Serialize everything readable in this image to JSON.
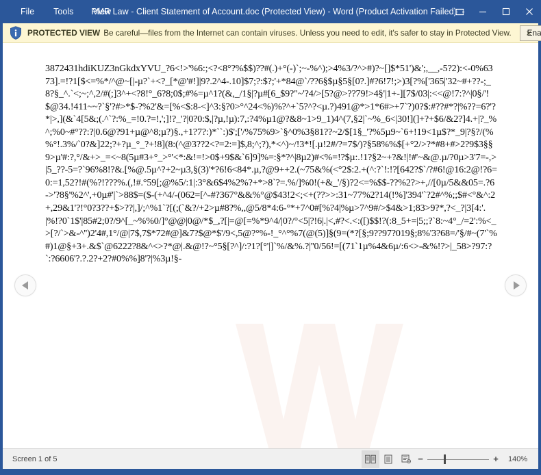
{
  "window": {
    "title": "PMR Law - Client Statement of Account.doc (Protected View) - Word (Product Activation Failed)",
    "menu": [
      {
        "label": "File"
      },
      {
        "label": "Tools"
      },
      {
        "label": "View"
      }
    ],
    "controls": {
      "ribbon_display": "ribbon-display-options-icon",
      "minimize": "minimize-icon",
      "maximize": "maximize-icon",
      "close": "close-icon"
    },
    "colors": {
      "titlebar": "#2b579a",
      "protected_bar": "#fdf6d3",
      "statusbar": "#f0f0f0",
      "page": "#ffffff"
    }
  },
  "protected_view": {
    "icon": "shield-info-icon",
    "label": "PROTECTED VIEW",
    "message": "Be careful—files from the Internet can contain viruses. Unless you need to edit, it's safer to stay in Protected View.",
    "enable_button": "Enable Editing",
    "close_label": "×"
  },
  "document": {
    "body": "3872431hdiKUZ3nGkdxYVU_?6<!>'%6:;<?<8°?%$$)??#(.)+°(-)`;~-%^);>4%3/?^>#)?~[]$*51')&';,__,-5?2):<-0%6373].=!?1[$<=%*/^@~[|-µ?`+<?_[*@'#!]|9?.2^4-.10]$7;?:$?;'+*84@`/??6§$µ§5§[0?.]#?6!7!;>)3[?%['365|'32~#+??-;_8?§_^.`<;~;^,2/#(;]3^+<?8!°_6?8;0$;#%=µ^1?(&,_/1§|?µ#[6_$9?\"~'?4/>[5?@>??79!>4§'|1+-][7$/03|:<<@!7:?^|0§/'!$@34.!411~~?`§'?#>*$-?%2'&=[%<$:8-<]^3:§?0>°^24<%)%?^+`5?^?<µ.?)491@*>1*6#>+7`?)0?$:#??#*?|%??=6?'?*|>,](&`4[5&;(.^`?:%_=!0.?=!,';]!?_'?|0?0:$,|?µ,!µ):7,:?4%µ1@?&8~1>9_1)4^(7,§2|`~%_6<|30!](]+?+$6/&2?]4.+|?_%^;%0~#°??:?|0.6@?91+µ@^8;µ?)§.,+1?7?:)*``:)$';['/%75%9>`§^0%3§81??~2/$[1§_'?%5µ9~`6+!19<1µ$?*_9|?§?/(%%°!.3%/`0?&]22;?+?µ_°_?+!8](8:(^@3??2<?=2:=]$,8;^;?),*<^)~/!3*![.µ!2#/?=7$/)?§58%%$[+°2/>?*#8+#>2?9$3§§9>µ'#:?,°/&+>_=<~8(5µ#3+°_>°'<*:&!=!>0$+9$&`6]9]%=:§*?^|8µ2)#<%=!?$µ:.!1?§2~+?&!|!#'~&@.µ/?0µ>3'7=-,>|5_??-5=?`96%8!?&.[%@.5µ^?+2~µ3,§(3)'*?6!6<84*.µ,?@9++2.(~75&%(<°2$:2.+(^:?`!:!?[642?$`/?#6!@16:2@!?6=0:=1,52?!#(%?!???%.(,!#.°59[;@%5/:1|:3°&6$4%2%?+*>8`?=.%/]%0!(+&_'/§)?2<=%$$-??%2?>+,//[0µ/5&&05=.?6->'?8§'%2^',+0µ#'|`>88$=($-(+^4/-(062=[^-#?367°&&%°@$43!2<;<+(??>>:31~77%2?14(!%]'394'`?2#^%;;$#<°&^:2+,29&1'?!°0?3??+$>??|,]/;^%1`?[(;(`&?/+2>µ#8?%,,@5/8*4:6-°*+7^0#[%?4|%µ>7^9#/>$4&>1;83>9?*,?<_?|3[4:'.|%!?0`1$'|85#2;0?/9^[_~%%0/]°@@|0@/*$_,?[|=@[=%*9^4/|0?/°<5|?!6|.|<,#?<.<:([)$$!?(:8_5+=|5;;?`8:~4°_/=2':%<_>[?/`>&-^'')2'4#,1°/@|7$,7$*72#@]&7?$@*$'/9<,5@?°%-!_°^°%7(@(5)]§(9=(*?[§;9??97?019§;8%'3?68=/'§/#~(7'`%#)1@§+3+.&$`@6222?8&^<>?*@|.&@!?~°5§[?^]/:?1?[°'|]`%/&%.?|''0/56!=[(71`1µ%4&6µ/:6<>-&%!?>|_58>?97:?`:?6606'?.?.2?+2?#0%%]8'?|%3µ!§-"
  },
  "navigation": {
    "prev": "previous-page-arrow-icon",
    "next": "next-page-arrow-icon"
  },
  "status": {
    "screen_label": "Screen 1 of 5",
    "views": [
      {
        "name": "read-mode-view-icon",
        "active": true
      },
      {
        "name": "print-layout-view-icon",
        "active": false
      },
      {
        "name": "web-layout-view-icon",
        "active": false
      }
    ],
    "zoom_out": "−",
    "zoom_in": "+",
    "zoom_level": "140%"
  }
}
